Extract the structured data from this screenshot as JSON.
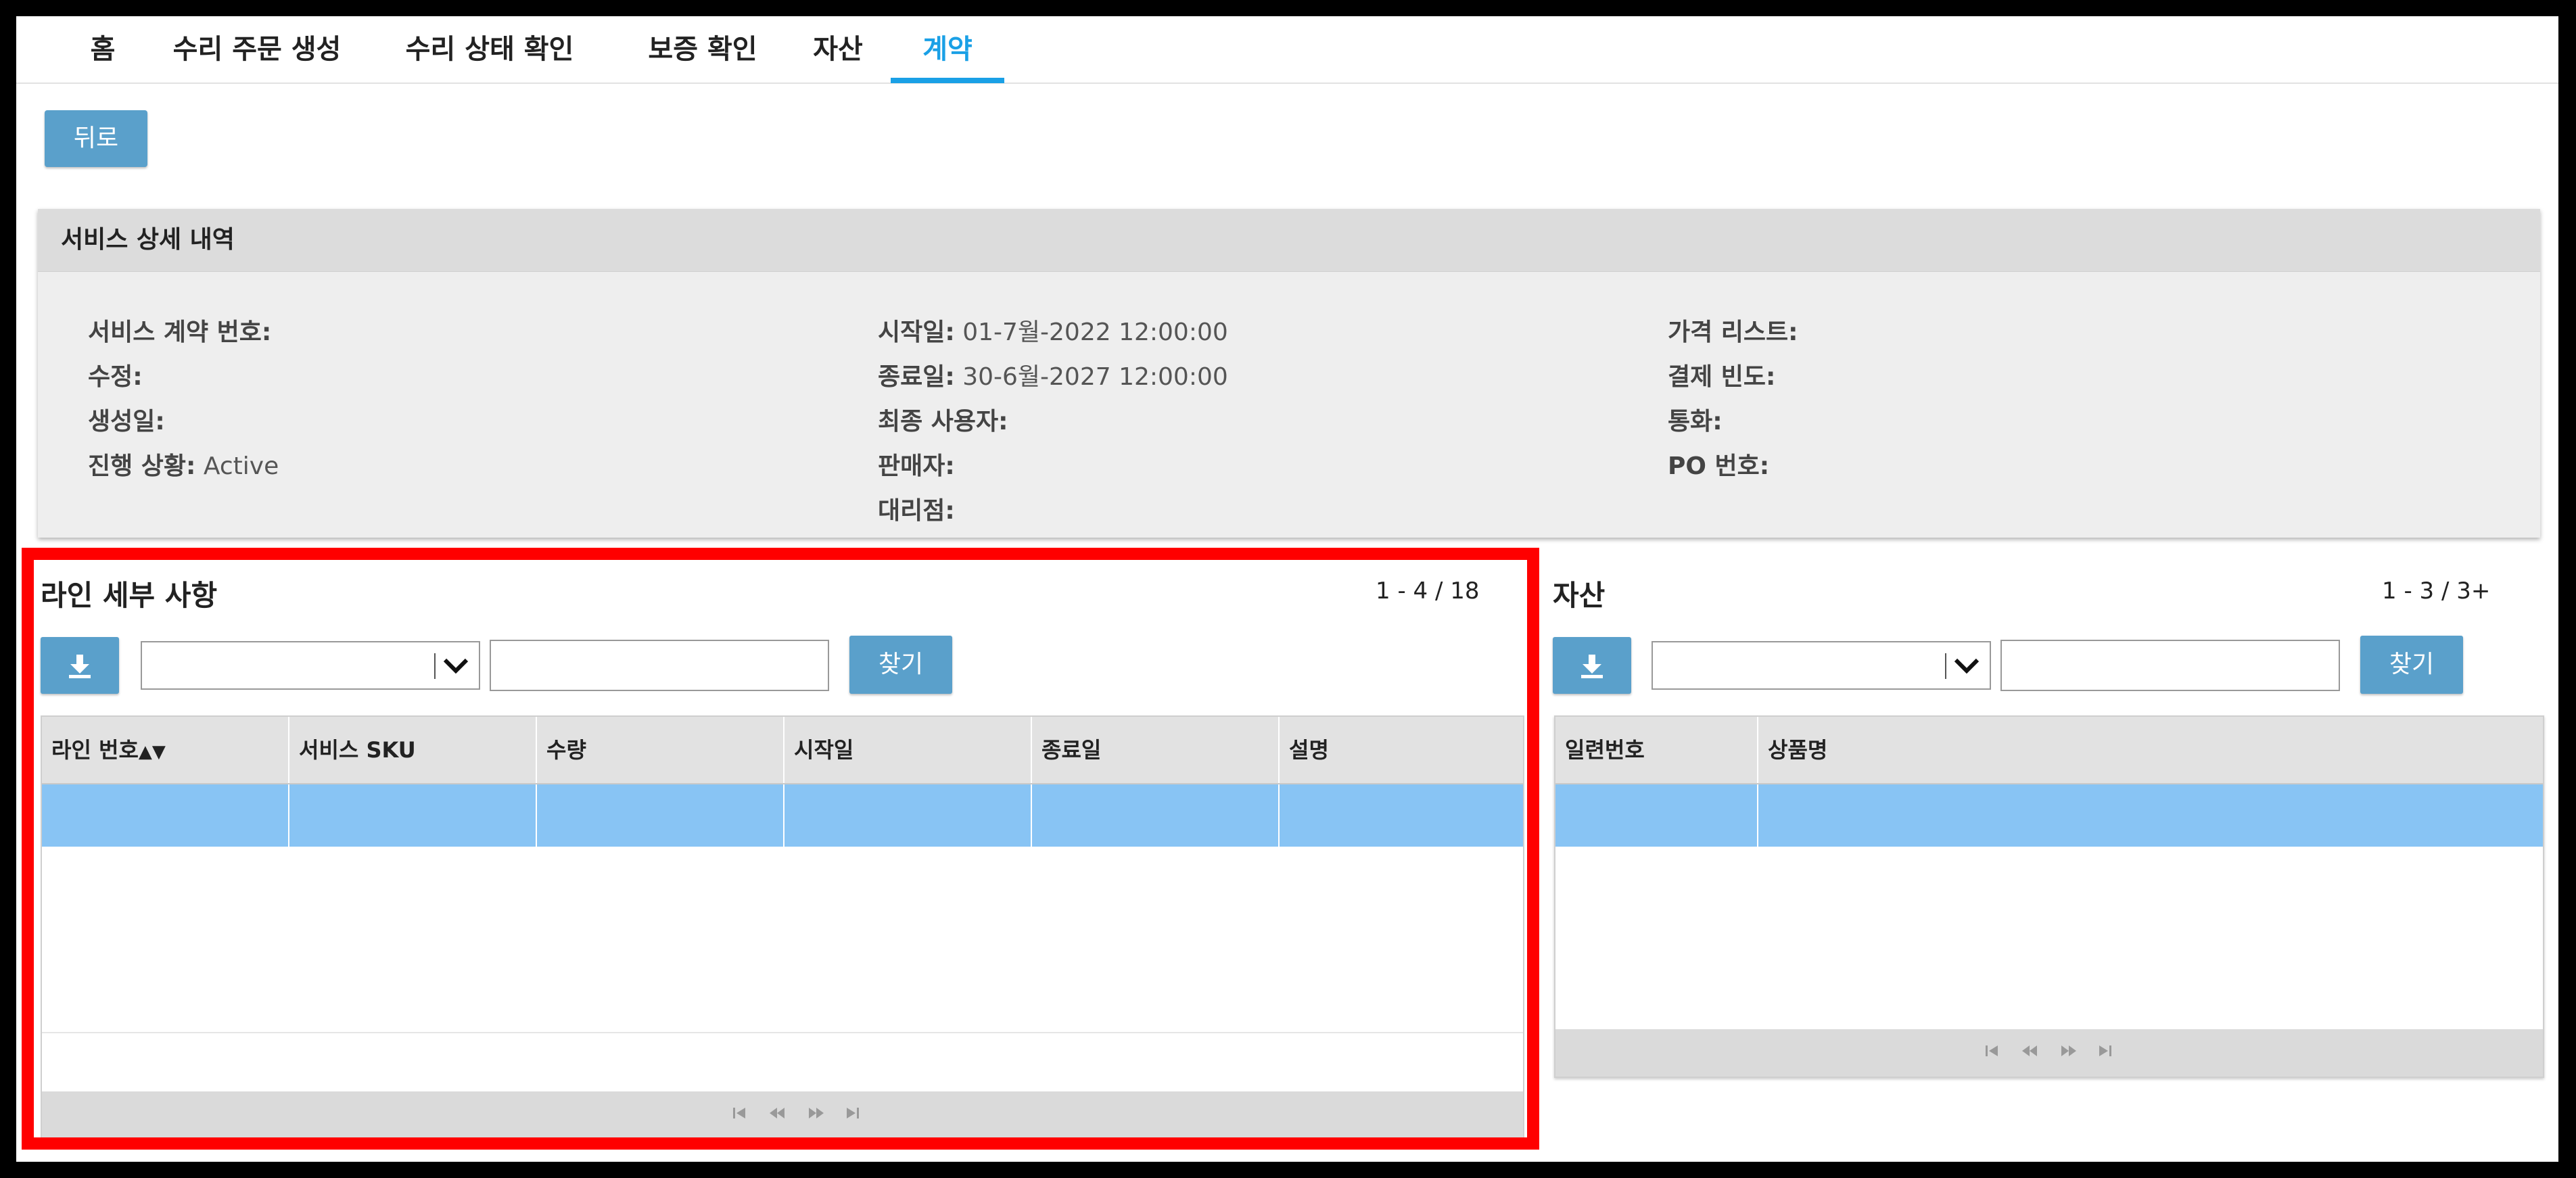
{
  "nav": {
    "tabs": [
      "홈",
      "수리 주문 생성",
      "수리 상태 확인",
      "보증 확인",
      "자산",
      "계약"
    ],
    "active_index": 5
  },
  "back_label": "뒤로",
  "service": {
    "title": "서비스 상세 내역",
    "col1": [
      {
        "label": "서비스 계약 번호:",
        "value": ""
      },
      {
        "label": "수정:",
        "value": ""
      },
      {
        "label": "생성일:",
        "value": ""
      },
      {
        "label": "진행 상황:",
        "value": "Active"
      }
    ],
    "col2": [
      {
        "label": "시작일:",
        "value": "01-7월-2022 12:00:00"
      },
      {
        "label": "종료일:",
        "value": "30-6월-2027 12:00:00"
      },
      {
        "label": "최종 사용자:",
        "value": ""
      },
      {
        "label": "판매자:",
        "value": ""
      },
      {
        "label": "대리점:",
        "value": ""
      }
    ],
    "col3": [
      {
        "label": "가격 리스트:",
        "value": ""
      },
      {
        "label": "결제 빈도:",
        "value": ""
      },
      {
        "label": "통화:",
        "value": ""
      },
      {
        "label": "PO 번호:",
        "value": ""
      }
    ]
  },
  "lines": {
    "title": "라인 세부 사항",
    "count": "1 - 4 / 18",
    "find_label": "찾기",
    "select_value": "",
    "search_value": "",
    "columns": [
      "라인 번호",
      "서비스 SKU",
      "수량",
      "시작일",
      "종료일",
      "설명"
    ],
    "sort_icon": "▲▼"
  },
  "assets": {
    "title": "자산",
    "count": "1 - 3 / 3+",
    "find_label": "찾기",
    "select_value": "",
    "search_value": "",
    "columns": [
      "일련번호",
      "상품명"
    ]
  },
  "colors": {
    "accent": "#1aa0e6",
    "button": "#5aa0cb",
    "selected_row": "#88c4f4",
    "highlight": "#ff0000"
  }
}
